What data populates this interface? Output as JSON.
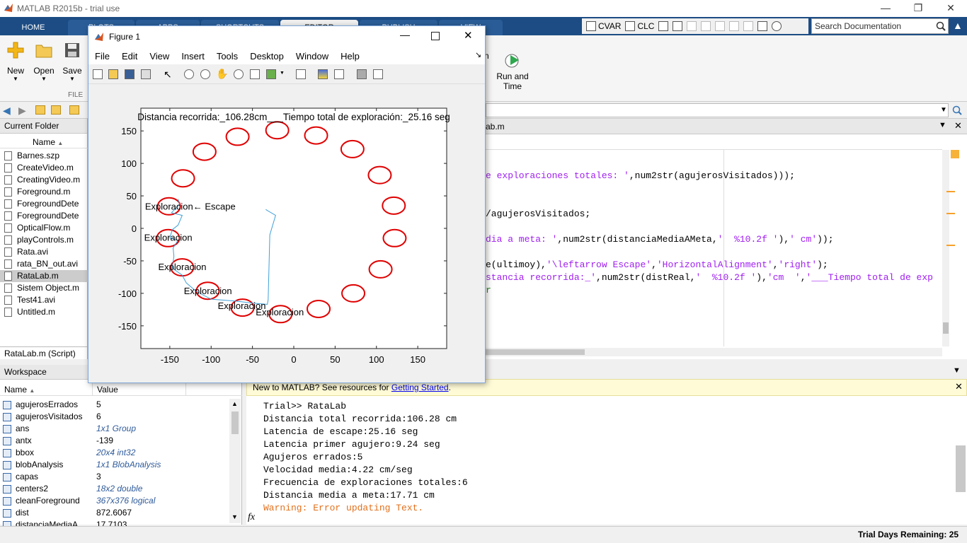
{
  "app": {
    "title": "MATLAB R2015b - trial use"
  },
  "tabs": [
    "HOME",
    "PLOTS",
    "APPS",
    "SHORTCUTS",
    "EDITOR",
    "PUBLISH",
    "VIEW"
  ],
  "quick_access": {
    "cvar": "CVAR",
    "clc": "CLC"
  },
  "search": {
    "placeholder": "Search Documentation"
  },
  "ribbon": {
    "new": "New",
    "open": "Open",
    "save": "Save",
    "run_time": "Run and\nTime",
    "file_section": "FILE",
    "run_partial": "n"
  },
  "current_folder": {
    "header": "Current Folder",
    "col_name": "Name",
    "files": [
      "Barnes.szp",
      "CreateVideo.m",
      "CreatingVideo.m",
      "Foreground.m",
      "ForegroundDete",
      "ForegroundDete",
      "OpticalFlow.m",
      "playControls.m",
      "Rata.avi",
      "rata_BN_out.avi",
      "RataLab.m",
      "Sistem Object.m",
      "Test41.avi",
      "Untitled.m"
    ],
    "selected": "RataLab.m",
    "footer": "RataLab.m  (Script)"
  },
  "editor": {
    "tab": "ab.m",
    "lines": [
      {
        "parts": [
          {
            "t": "e exploraciones totales: '",
            "c": "#a020f0"
          },
          {
            "t": ",num2str(agujerosVisitados)));",
            "c": "#000"
          }
        ]
      },
      {
        "parts": [
          {
            "t": "/agujerosVisitados;",
            "c": "#000"
          }
        ]
      },
      {
        "parts": [
          {
            "t": "dia a meta: '",
            "c": "#a020f0"
          },
          {
            "t": ",num2str(distanciaMediaAMeta,",
            "c": "#000"
          },
          {
            "t": "'  %10.2f '",
            "c": "#a020f0"
          },
          {
            "t": "),",
            "c": "#000"
          },
          {
            "t": "' cm'",
            "c": "#a020f0"
          },
          {
            "t": "));",
            "c": "#000"
          }
        ]
      },
      {
        "parts": [
          {
            "t": "e(ultimoy),",
            "c": "#000"
          },
          {
            "t": "'\\leftarrow Escape'",
            "c": "#a020f0"
          },
          {
            "t": ",",
            "c": "#000"
          },
          {
            "t": "'HorizontalAlignment'",
            "c": "#a020f0"
          },
          {
            "t": ",",
            "c": "#000"
          },
          {
            "t": "'right'",
            "c": "#a020f0"
          },
          {
            "t": ");",
            "c": "#000"
          }
        ]
      },
      {
        "parts": [
          {
            "t": "stancia recorrida:_'",
            "c": "#a020f0"
          },
          {
            "t": ",num2str(distReal,",
            "c": "#000"
          },
          {
            "t": "'  %10.2f '",
            "c": "#a020f0"
          },
          {
            "t": "),",
            "c": "#000"
          },
          {
            "t": "'cm  '",
            "c": "#a020f0"
          },
          {
            "t": ",",
            "c": "#000"
          },
          {
            "t": "'___Tiempo total de exp",
            "c": "#a020f0"
          }
        ]
      },
      {
        "parts": [
          {
            "t": "r",
            "c": "#228b22"
          }
        ]
      }
    ]
  },
  "workspace": {
    "header": "Workspace",
    "col_name": "Name",
    "col_value": "Value",
    "vars": [
      {
        "name": "agujerosErrados",
        "value": "5",
        "obj": false
      },
      {
        "name": "agujerosVisitados",
        "value": "6",
        "obj": false
      },
      {
        "name": "ans",
        "value": "1x1 Group",
        "obj": true
      },
      {
        "name": "antx",
        "value": "-139",
        "obj": false
      },
      {
        "name": "bbox",
        "value": "20x4 int32",
        "obj": true
      },
      {
        "name": "blobAnalysis",
        "value": "1x1 BlobAnalysis",
        "obj": true
      },
      {
        "name": "capas",
        "value": "3",
        "obj": false
      },
      {
        "name": "centers2",
        "value": "18x2 double",
        "obj": true
      },
      {
        "name": "cleanForeground",
        "value": "367x376 logical",
        "obj": true
      },
      {
        "name": "dist",
        "value": "872.6067",
        "obj": false
      },
      {
        "name": "distanciaMediaA...",
        "value": "17.7103",
        "obj": false
      }
    ]
  },
  "command_window": {
    "banner_text": "New to MATLAB? See resources for ",
    "banner_link": "Getting Started",
    "banner_end": ".",
    "lines": [
      "Trial>> RataLab",
      "Distancia total recorrida:106.28 cm",
      "Latencia de escape:25.16 seg",
      "Latencia primer agujero:9.24 seg",
      "Agujeros errados:5",
      "Velocidad media:4.22 cm/seg",
      "Frecuencia de exploraciones totales:6",
      "Distancia media a meta:17.71 cm"
    ],
    "warning": "Warning: Error updating Text.",
    "fx": "fx"
  },
  "status": {
    "trial": "Trial Days Remaining: 25"
  },
  "figure": {
    "title": "Figure 1",
    "menu": [
      "File",
      "Edit",
      "View",
      "Insert",
      "Tools",
      "Desktop",
      "Window",
      "Help"
    ]
  },
  "chart_data": {
    "type": "scatter",
    "title": "Distancia recorrida:_106.28cm___Tiempo total de exploración:_25.16 seg",
    "xlim": [
      -185,
      185
    ],
    "ylim": [
      -185,
      185
    ],
    "xticks": [
      -150,
      -100,
      -50,
      0,
      50,
      100,
      150
    ],
    "yticks": [
      150,
      100,
      50,
      0,
      -50,
      -100,
      -150
    ],
    "holes": [
      [
        -20,
        151
      ],
      [
        27,
        143
      ],
      [
        71,
        122
      ],
      [
        104,
        82
      ],
      [
        121,
        35
      ],
      [
        122,
        -15
      ],
      [
        105,
        -63
      ],
      [
        72,
        -100
      ],
      [
        30,
        -124
      ],
      [
        -16,
        -132
      ],
      [
        -62,
        -122
      ],
      [
        -104,
        -96
      ],
      [
        -135,
        -60
      ],
      [
        -152,
        -15
      ],
      [
        -151,
        34
      ],
      [
        -134,
        77
      ],
      [
        -108,
        118
      ],
      [
        -68,
        141
      ]
    ],
    "hole_color": "#e00000",
    "labels": [
      {
        "text": "Exploracion← Escape",
        "x": -180,
        "y": 29
      },
      {
        "text": "Exploracion",
        "x": -181,
        "y": -19
      },
      {
        "text": "Exploracion",
        "x": -164,
        "y": -64
      },
      {
        "text": "Exploracion",
        "x": -133,
        "y": -101
      },
      {
        "text": "Exploracion",
        "x": -92,
        "y": -124
      },
      {
        "text": "Exploracion",
        "x": -46,
        "y": -134
      }
    ],
    "path": [
      [
        -34,
        29
      ],
      [
        -22,
        20
      ],
      [
        -29,
        -10
      ],
      [
        -30,
        -60
      ],
      [
        -31,
        -110
      ],
      [
        -32,
        -117
      ],
      [
        -50,
        -115
      ],
      [
        -70,
        -112
      ],
      [
        -100,
        -109
      ],
      [
        -118,
        -97
      ],
      [
        -130,
        -84
      ],
      [
        -135,
        -72
      ],
      [
        -147,
        -61
      ],
      [
        -145,
        -43
      ],
      [
        -146,
        -30
      ],
      [
        -140,
        -18
      ],
      [
        -150,
        -15
      ],
      [
        -147,
        -2
      ],
      [
        -140,
        5
      ],
      [
        -135,
        20
      ],
      [
        -148,
        24
      ],
      [
        -138,
        37
      ],
      [
        -140,
        45
      ]
    ],
    "path_color": "#3ea0d8",
    "grid": false
  }
}
